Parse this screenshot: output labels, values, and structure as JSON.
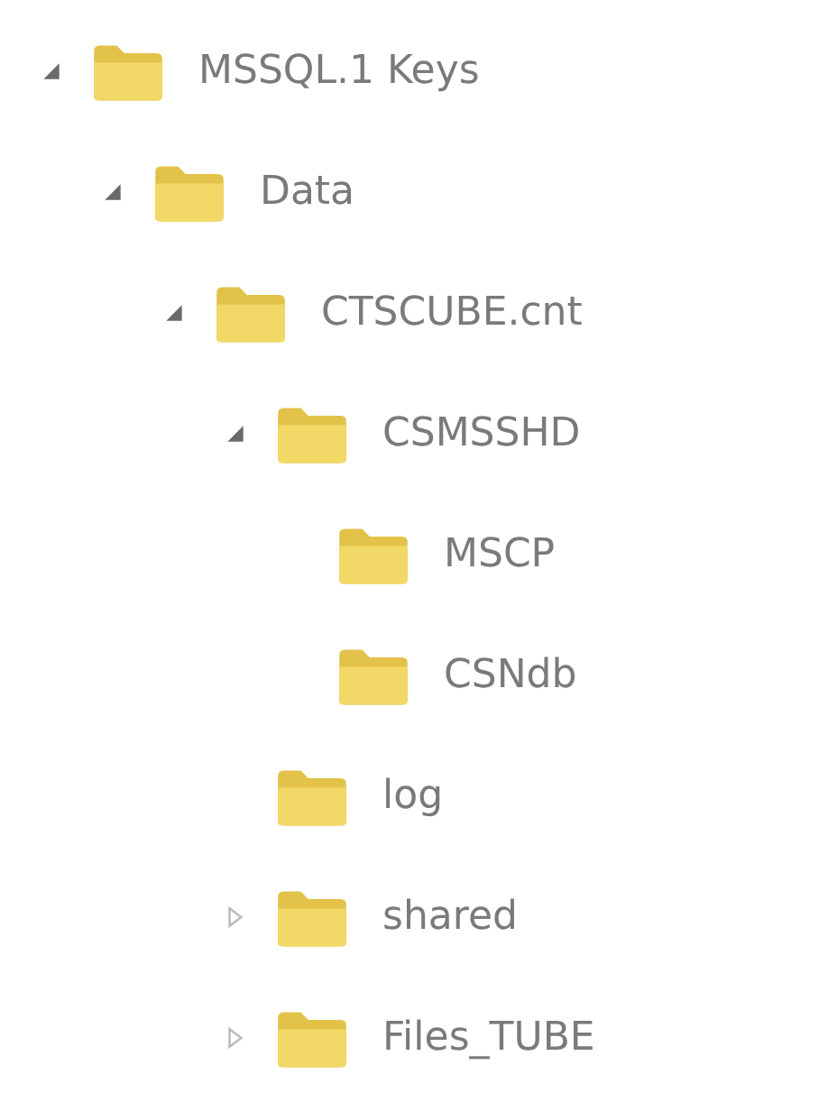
{
  "tree": [
    {
      "label": "MSSQL.1 Keys",
      "expanded": true,
      "children": [
        {
          "label": "Data",
          "expanded": true,
          "children": [
            {
              "label": "CTSCUBE.cnt",
              "expanded": true,
              "children": [
                {
                  "label": "CSMSSHD",
                  "expanded": true,
                  "children": [
                    {
                      "label": "MSCP"
                    },
                    {
                      "label": "CSNdb"
                    }
                  ]
                },
                {
                  "label": "log"
                },
                {
                  "label": "shared",
                  "expanded": false
                },
                {
                  "label": "Files_TUBE",
                  "expanded": false
                }
              ]
            }
          ]
        }
      ]
    }
  ]
}
